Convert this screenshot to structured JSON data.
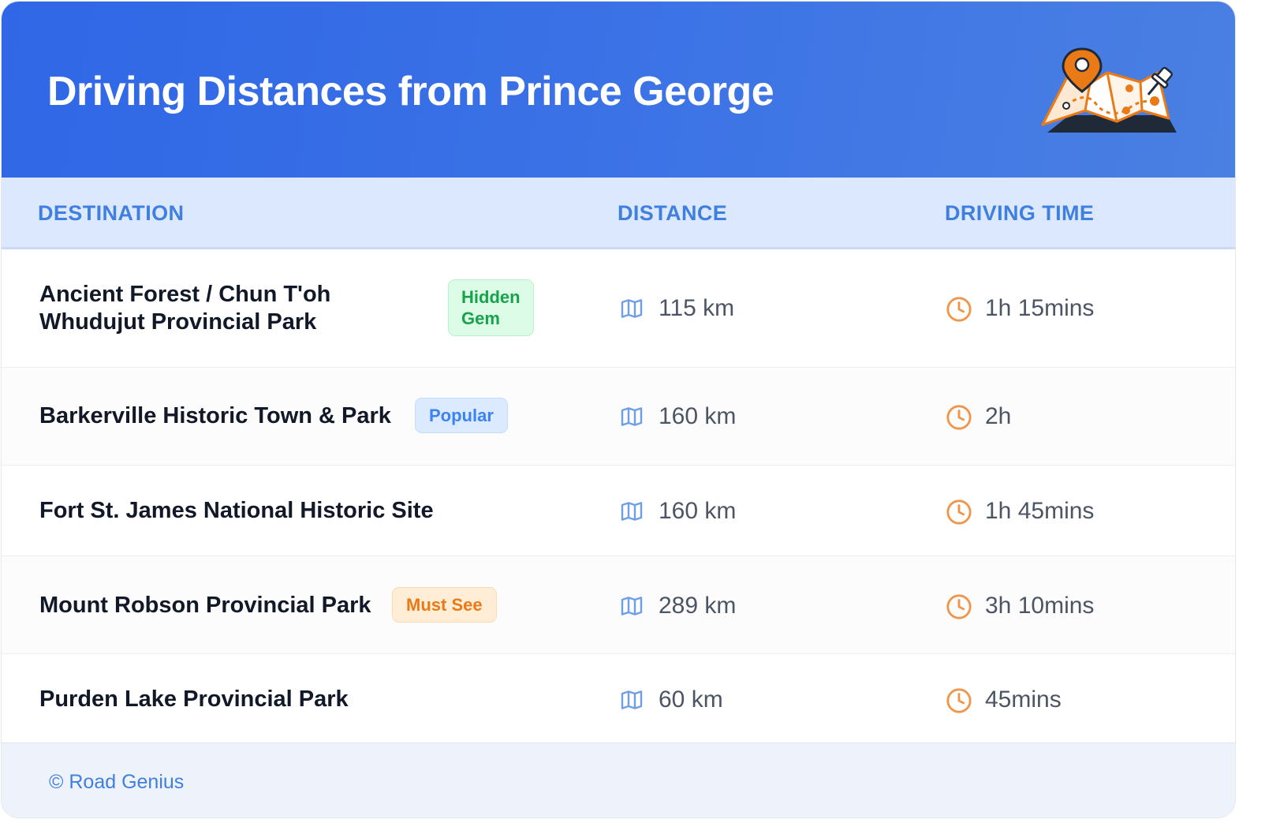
{
  "header": {
    "title": "Driving Distances from Prince George",
    "illustration_icon": "map-pin-icon"
  },
  "table": {
    "columns": [
      "DESTINATION",
      "DISTANCE",
      "DRIVING TIME"
    ],
    "rows": [
      {
        "destination_line1": "Ancient Forest / Chun T'oh",
        "destination_line2": "Whudujut Provincial Park",
        "badge_line1": "Hidden",
        "badge_line2": "Gem",
        "badge_color": "green",
        "distance": "115 km",
        "time": "1h 15mins"
      },
      {
        "destination": "Barkerville Historic Town & Park",
        "badge": "Popular",
        "badge_color": "blue",
        "distance": "160 km",
        "time": "2h"
      },
      {
        "destination": "Fort St. James National Historic Site",
        "distance": "160 km",
        "time": "1h 45mins"
      },
      {
        "destination": "Mount Robson Provincial Park",
        "badge": "Must See",
        "badge_color": "orange",
        "distance": "289 km",
        "time": "3h 10mins"
      },
      {
        "destination": "Purden Lake Provincial Park",
        "distance": "60 km",
        "time": "45mins"
      }
    ]
  },
  "icons": {
    "distance": "map-icon",
    "time": "clock-icon"
  },
  "colors": {
    "header_blue": "#2f67e6",
    "accent_blue": "#3f7fe0",
    "clock_orange": "#f0954a",
    "map_blue": "#6f9ee8"
  },
  "footer": {
    "text": "© Road Genius"
  }
}
